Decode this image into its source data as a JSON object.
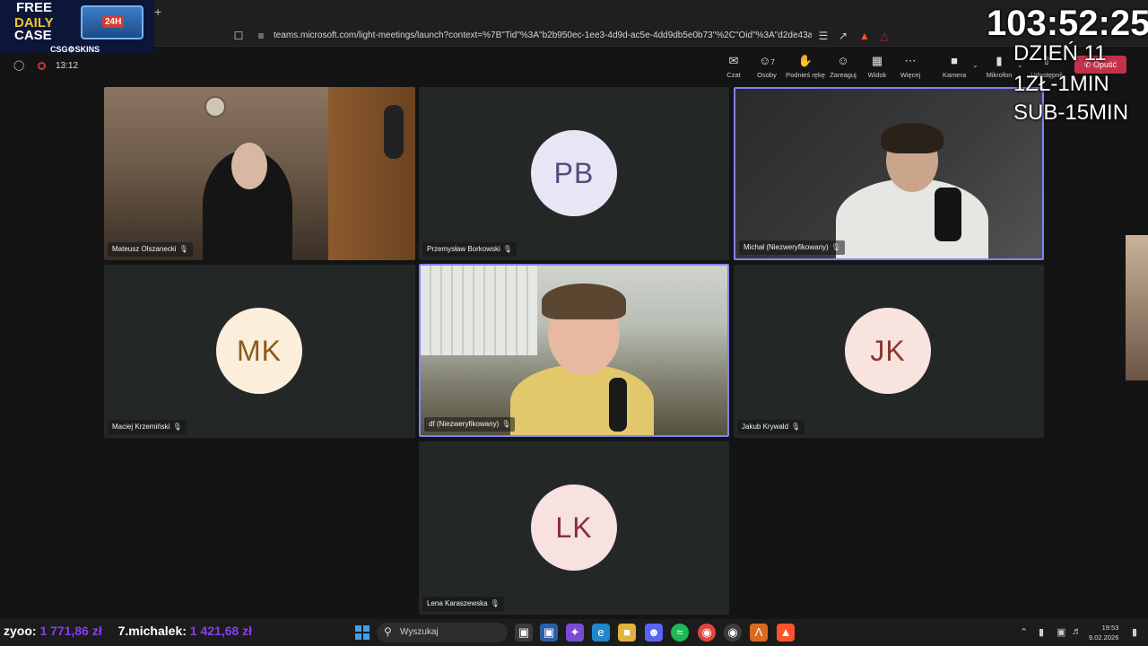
{
  "browser": {
    "new_tab_label": "+",
    "url": "teams.microsoft.com/light-meetings/launch?context=%7B\"Tid\"%3A\"b2b950ec-1ee3-4d9d-ac5e-4dd9db5e0b73\"%2C\"Oid\"%3A\"d2de43ac-467e..."
  },
  "meeting": {
    "elapsed": "13:12",
    "toolbar": [
      {
        "label": "Czat",
        "icon": "chat-icon",
        "glyph": "✉"
      },
      {
        "label": "Osoby",
        "icon": "people-icon",
        "glyph": "☺",
        "count": "7"
      },
      {
        "label": "Podnieś rękę",
        "icon": "raise-hand-icon",
        "glyph": "✋"
      },
      {
        "label": "Zareaguj",
        "icon": "react-icon",
        "glyph": "☺"
      },
      {
        "label": "Widok",
        "icon": "view-icon",
        "glyph": "▦"
      },
      {
        "label": "Więcej",
        "icon": "more-icon",
        "glyph": "⋯"
      },
      {
        "label": "Kamera",
        "icon": "camera-icon",
        "glyph": "■"
      },
      {
        "label": "Mikrofon",
        "icon": "microphone-icon",
        "glyph": "▮"
      },
      {
        "label": "Udostępnij",
        "icon": "share-icon",
        "glyph": "⇧"
      }
    ],
    "leave_label": "Opuść"
  },
  "participants": [
    {
      "name": "Mateusz Olszanecki",
      "initials": "",
      "video": true
    },
    {
      "name": "Przemysław Borkowski",
      "initials": "PB",
      "avatar_bg": "#e8e6f5",
      "avatar_fg": "#4f4b7d"
    },
    {
      "name": "Michał (Niezweryfikowany)",
      "initials": "",
      "video": true,
      "speaking": true
    },
    {
      "name": "Maciej Krzemiński",
      "initials": "MK",
      "avatar_bg": "#fbefdc",
      "avatar_fg": "#8a5a1f"
    },
    {
      "name": "df (Niezweryfikowany)",
      "initials": "",
      "video": true,
      "speaking": true
    },
    {
      "name": "Jakub Krywald",
      "initials": "JK",
      "avatar_bg": "#f8e3df",
      "avatar_fg": "#8a3a2c"
    },
    {
      "name": "Lena Karaszewska",
      "initials": "LK",
      "avatar_bg": "#f7e1e1",
      "avatar_fg": "#8a2f3b"
    }
  ],
  "overlay": {
    "timer": "103:52:25",
    "line1": "DZIEŃ 11",
    "line2": "1ZŁ-1MIN",
    "line3": "SUB-15MIN",
    "promo_free": "FREE",
    "promo_daily": "DAILY",
    "promo_case": "CASE",
    "promo_brand": "CSG⚙SKINS",
    "promo_badge": "24H"
  },
  "donations": [
    {
      "name": "zyoo:",
      "amount": "1 771,86 zł"
    },
    {
      "name": "7.michalek:",
      "amount": "1 421,68 zł"
    }
  ],
  "taskbar": {
    "search_placeholder": "Wyszukaj",
    "time": "19:53",
    "date": "9.02.2026"
  },
  "colors": {
    "active_border": "#7f85f5",
    "leave_red": "#c4314b",
    "donation_amount": "#8a3cf4"
  }
}
